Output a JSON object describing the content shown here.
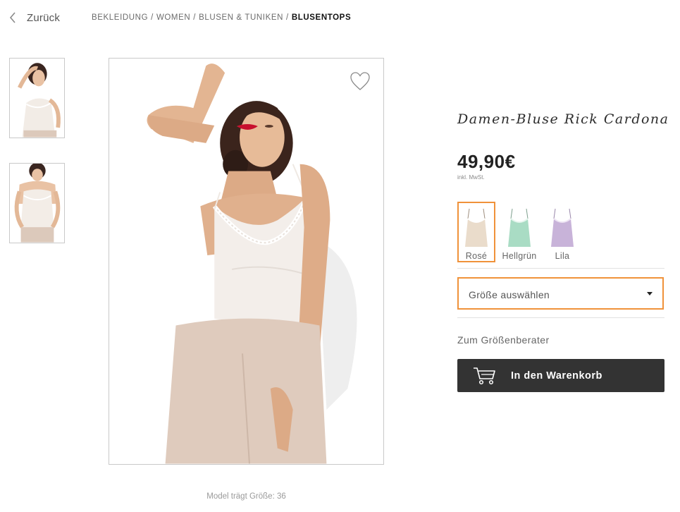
{
  "nav": {
    "back_label": "Zurück",
    "breadcrumb": [
      "BEKLEIDUNG",
      "WOMEN",
      "BLUSEN & TUNIKEN"
    ],
    "breadcrumb_separator": "/",
    "breadcrumb_current": "BLUSENTOPS"
  },
  "gallery": {
    "thumbnail_count": 2,
    "model_note": "Model trägt Größe: 36"
  },
  "product": {
    "title": "Damen-Bluse Rick Cardona",
    "price": "49,90€",
    "vat_note": "inkl. MwSt.",
    "colors": [
      {
        "label": "Rosé",
        "hex": "#eadccb",
        "selected": true
      },
      {
        "label": "Hellgrün",
        "hex": "#a9dcc4",
        "selected": false
      },
      {
        "label": "Lila",
        "hex": "#c8b3d9",
        "selected": false
      }
    ],
    "size_placeholder": "Größe auswählen",
    "size_guide_label": "Zum Größenberater",
    "add_to_cart_label": "In den Warenkorb"
  },
  "theme": {
    "accent": "#f0923a",
    "button_bg": "#333333"
  }
}
